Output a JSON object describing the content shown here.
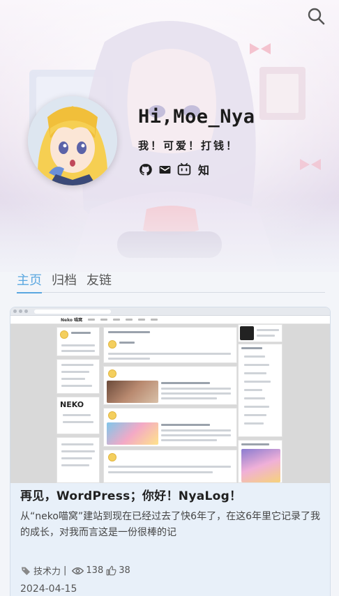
{
  "header": {
    "search_icon": "search-icon"
  },
  "profile": {
    "name": "Hi,Moe_Nya",
    "motto": "我！可爱！打钱！",
    "social": [
      {
        "icon": "github-icon"
      },
      {
        "icon": "mail-icon"
      },
      {
        "icon": "bilibili-icon"
      },
      {
        "icon": "zhihu-icon",
        "label": "知"
      }
    ]
  },
  "tabs": [
    {
      "label": "主页",
      "active": true
    },
    {
      "label": "归档",
      "active": false
    },
    {
      "label": "友链",
      "active": false
    }
  ],
  "post": {
    "title": "再见，WordPress；你好！NyaLog！",
    "excerpt": "从“neko喵窝”建站到现在已经过去了快6年了，在这6年里它记录了我的成长，对我而言这是一份很棒的记",
    "category": "技术力",
    "separator": "|",
    "views": "138",
    "likes": "38",
    "date": "2024-04-15"
  },
  "thumbnail": {
    "brand": "Neko 喵窝",
    "logo_text": "NEKO"
  },
  "colors": {
    "accent": "#5aa7e0",
    "card_bg": "#e8f0f9",
    "text_dark": "#1f1f1f"
  }
}
